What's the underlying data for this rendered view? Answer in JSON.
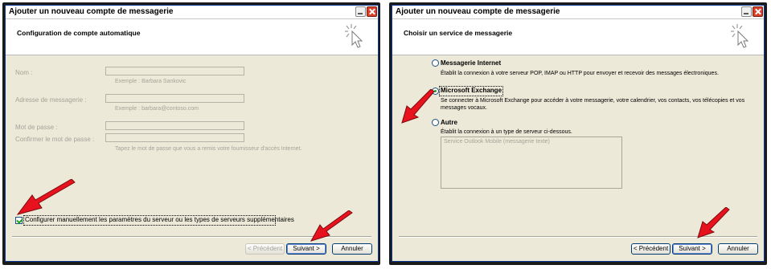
{
  "left_dialog": {
    "title": "Ajouter un nouveau compte de messagerie",
    "header_title": "Configuration de compte automatique",
    "fields": {
      "name_label": "Nom :",
      "name_value": "",
      "name_example": "Exemple : Barbara Sankovic",
      "email_label": "Adresse de messagerie :",
      "email_value": "",
      "email_example": "Exemple : barbara@contoso.com",
      "password_label": "Mot de passe :",
      "password_value": "",
      "confirm_label": "Confirmer le mot de passe :",
      "confirm_value": "",
      "password_hint": "Tapez le mot de passe que vous a remis votre fournisseur d'accès Internet."
    },
    "manual_checkbox": {
      "label": "Configurer manuellement les paramètres du serveur ou les types de serveurs supplémentaires",
      "checked": true
    },
    "buttons": {
      "previous": "< Précédent",
      "next": "Suivant >",
      "cancel": "Annuler"
    }
  },
  "right_dialog": {
    "title": "Ajouter un nouveau compte de messagerie",
    "header_title": "Choisir un service de messagerie",
    "options": [
      {
        "label": "Messagerie Internet",
        "selected": false,
        "description": "Établit la connexion à votre serveur POP, IMAP ou HTTP pour envoyer et recevoir des messages électroniques."
      },
      {
        "label": "Microsoft Exchange",
        "selected": true,
        "description": "Se connecter à Microsoft Exchange pour accéder à votre messagerie, votre calendrier, vos contacts, vos télécopies et vos messages vocaux."
      },
      {
        "label": "Autre",
        "selected": false,
        "description": "Établit la connexion à un type de serveur ci-dessous."
      }
    ],
    "other_list": [
      "Service Outlook Mobile (messagerie texte)"
    ],
    "buttons": {
      "previous": "< Précédent",
      "next": "Suivant >",
      "cancel": "Annuler"
    }
  },
  "colors": {
    "arrow": "#e8121e",
    "dialog_bg": "#ece9d8",
    "window_border": "#0b3a93",
    "disabled_text": "#a6a39a"
  }
}
